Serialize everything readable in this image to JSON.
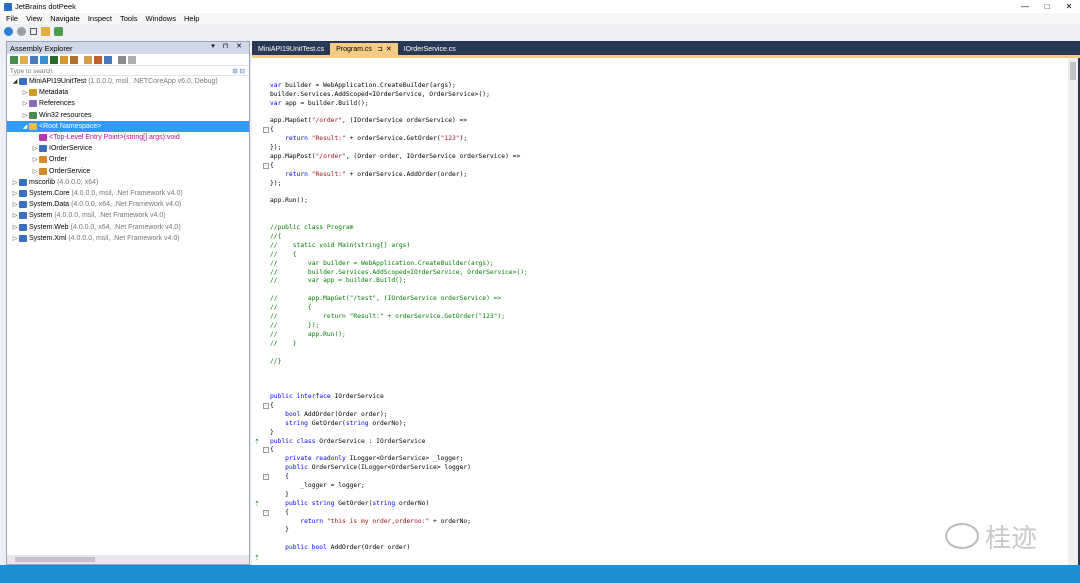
{
  "window": {
    "title": "JetBrains dotPeek",
    "min": "—",
    "max": "□",
    "close": "✕"
  },
  "menu": [
    "File",
    "View",
    "Navigate",
    "Inspect",
    "Tools",
    "Windows",
    "Help"
  ],
  "explorer": {
    "title": "Assembly Explorer",
    "header_controls": "▾ ⊓ ✕",
    "search_placeholder": "Type to search",
    "tree": [
      {
        "label": "MiniAPI19UnitTest",
        "meta": "(1.0.0.0, msil, .NETCoreApp v6.0, Debug)",
        "indent": 0,
        "arrow": "◢",
        "icon": "assembly",
        "color": "#3a6fbf"
      },
      {
        "label": "Metadata",
        "meta": "",
        "indent": 1,
        "arrow": "▷",
        "icon": "meta",
        "color": "#d19a2a"
      },
      {
        "label": "References",
        "meta": "",
        "indent": 1,
        "arrow": "▷",
        "icon": "refs",
        "color": "#8a6bb3"
      },
      {
        "label": "Win32 resources",
        "meta": "",
        "indent": 1,
        "arrow": "▷",
        "icon": "res",
        "color": "#4a8a4a"
      },
      {
        "label": "<Root Namespace>",
        "meta": "",
        "indent": 1,
        "arrow": "◢",
        "icon": "ns",
        "color": "#e8c04a",
        "selected": true
      },
      {
        "label": "<Top-Level Entry Point>(string[] args):void",
        "meta": "",
        "indent": 2,
        "arrow": "",
        "icon": "method",
        "color": "#b03ab0",
        "pink": true
      },
      {
        "label": "IOrderService",
        "meta": "",
        "indent": 2,
        "arrow": "▷",
        "icon": "iface",
        "color": "#3a6fbf"
      },
      {
        "label": "Order",
        "meta": "",
        "indent": 2,
        "arrow": "▷",
        "icon": "class",
        "color": "#d18a2a"
      },
      {
        "label": "OrderService",
        "meta": "",
        "indent": 2,
        "arrow": "▷",
        "icon": "class",
        "color": "#d18a2a"
      },
      {
        "label": "mscorlib",
        "meta": "(4.0.0.0, x64)",
        "indent": 0,
        "arrow": "▷",
        "icon": "assembly",
        "color": "#3a6fbf"
      },
      {
        "label": "System.Core",
        "meta": "(4.0.0.0, msil, .Net Framework v4.0)",
        "indent": 0,
        "arrow": "▷",
        "icon": "assembly",
        "color": "#3a6fbf"
      },
      {
        "label": "System.Data",
        "meta": "(4.0.0.0, x64, .Net Framework v4.0)",
        "indent": 0,
        "arrow": "▷",
        "icon": "assembly",
        "color": "#3a6fbf"
      },
      {
        "label": "System",
        "meta": "(4.0.0.0, msil, .Net Framework v4.0)",
        "indent": 0,
        "arrow": "▷",
        "icon": "assembly",
        "color": "#3a6fbf"
      },
      {
        "label": "System.Web",
        "meta": "(4.0.0.0, x64, .Net Framework v4.0)",
        "indent": 0,
        "arrow": "▷",
        "icon": "assembly",
        "color": "#3a6fbf"
      },
      {
        "label": "System.Xml",
        "meta": "(4.0.0.0, msil, .Net Framework v4.0)",
        "indent": 0,
        "arrow": "▷",
        "icon": "assembly",
        "color": "#3a6fbf"
      }
    ]
  },
  "tabs": [
    {
      "label": "MiniAPI19UnitTest.cs",
      "active": false
    },
    {
      "label": "Program.cs",
      "active": true,
      "pin": "⊐",
      "close": "✕"
    },
    {
      "label": "IOrderService.cs",
      "active": false
    }
  ],
  "code": [
    "",
    "var builder = WebApplication.CreateBuilder(args);",
    "builder.Services.AddScoped<IOrderService, OrderService>();",
    "var app = builder.Build();",
    "",
    "app.MapGet(\"/order\", (IOrderService orderService) =>",
    "{",
    "    return \"Result:\" + orderService.GetOrder(\"123\");",
    "});",
    "app.MapPost(\"/order\", (Order order, IOrderService orderService) =>",
    "{",
    "    return \"Result:\" + orderService.AddOrder(order);",
    "});",
    "",
    "app.Run();",
    "",
    "",
    "//public class Program",
    "//{",
    "//    static void Main(string[] args)",
    "//    {",
    "//        var builder = WebApplication.CreateBuilder(args);",
    "//        builder.Services.AddScoped<IOrderService, OrderService>();",
    "//        var app = builder.Build();",
    "",
    "//        app.MapGet(\"/test\", (IOrderService orderService) =>",
    "//        {",
    "//            return \"Result:\" + orderService.GetOrder(\"123\");",
    "//        });",
    "//        app.Run();",
    "//    }",
    "",
    "//}",
    "",
    "",
    "",
    "public interface IOrderService",
    "{",
    "    bool AddOrder(Order order);",
    "    string GetOrder(string orderNo);",
    "}",
    "public class OrderService : IOrderService",
    "{",
    "    private readonly ILogger<OrderService> _logger;",
    "    public OrderService(ILogger<OrderService> logger)",
    "    {",
    "        _logger = logger;",
    "    }",
    "    public string GetOrder(string orderNo)",
    "    {",
    "        return \"this is my order,orderno:\" + orderNo;",
    "    }",
    "",
    "    public bool AddOrder(Order order)"
  ],
  "fold_lines": [
    6,
    10,
    37,
    42,
    45,
    49
  ],
  "gutter_marks": [
    41,
    48,
    54
  ],
  "watermark": {
    "text": "桂迹",
    "icon": "wechat-icon"
  }
}
